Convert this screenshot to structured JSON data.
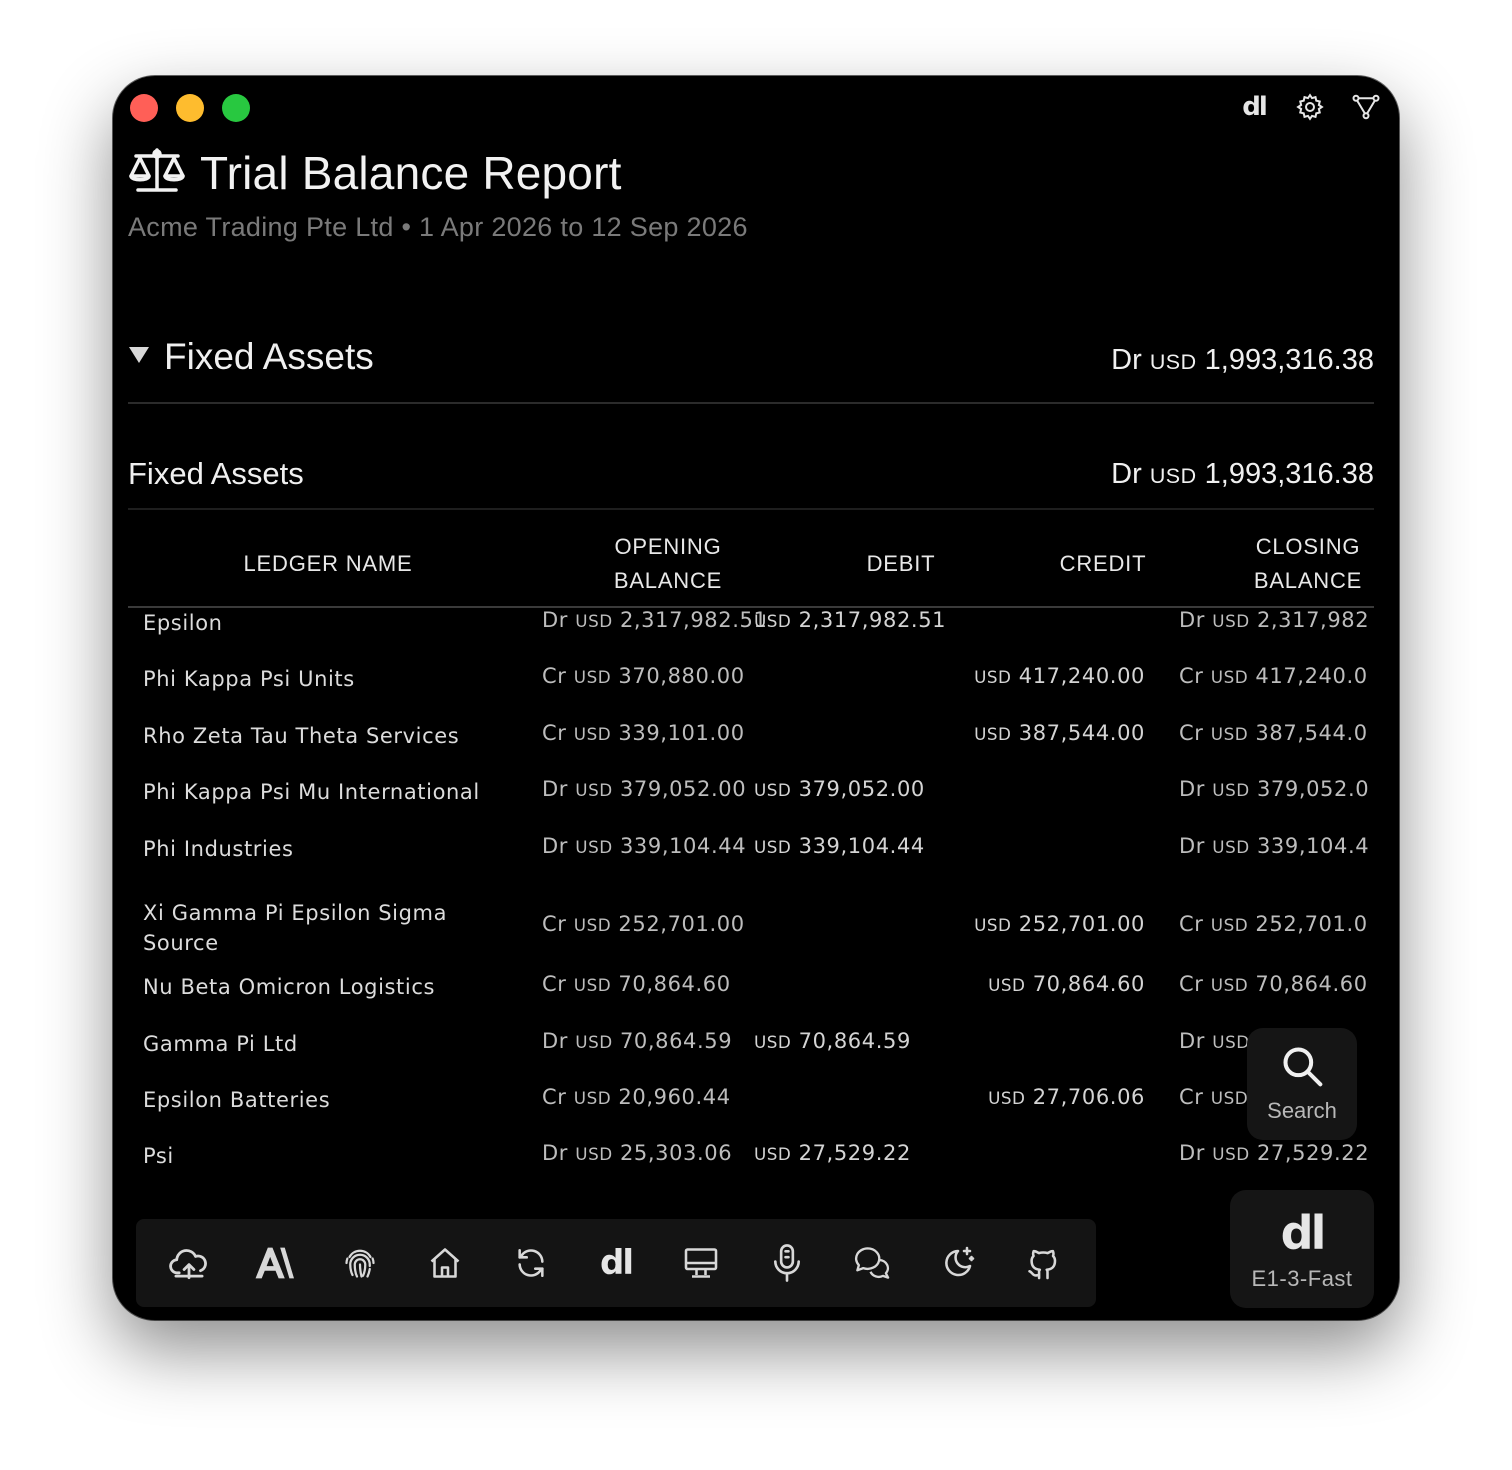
{
  "window": {
    "top_icons": [
      "dl-logo-icon",
      "gear-icon",
      "share-nodes-icon"
    ]
  },
  "header": {
    "title": "Trial Balance Report",
    "subtitle": "Acme Trading Pte Ltd • 1 Apr 2026 to 12 Sep 2026"
  },
  "group": {
    "title": "Fixed Assets",
    "amount_prefix": "Dr",
    "currency": "USD",
    "amount": "1,993,316.38"
  },
  "subgroup": {
    "title": "Fixed Assets",
    "amount_prefix": "Dr",
    "currency": "USD",
    "amount": "1,993,316.38"
  },
  "table": {
    "columns": {
      "ledger_name": "LEDGER NAME",
      "opening_line1": "OPENING",
      "opening_line2": "BALANCE",
      "debit": "DEBIT",
      "credit": "CREDIT",
      "closing_line1": "CLOSING",
      "closing_line2": "BALANCE"
    },
    "rows": [
      {
        "name": "Epsilon",
        "open_dc": "Dr",
        "open_cur": "USD",
        "open_amt": "2,317,982.51",
        "debit_cur": "USD",
        "debit_amt": "2,317,982.51",
        "credit_cur": "",
        "credit_amt": "",
        "close_dc": "Dr",
        "close_cur": "USD",
        "close_amt": "2,317,982"
      },
      {
        "name": "Phi Kappa Psi Units",
        "open_dc": "Cr",
        "open_cur": "USD",
        "open_amt": "370,880.00",
        "debit_cur": "",
        "debit_amt": "",
        "credit_cur": "USD",
        "credit_amt": "417,240.00",
        "close_dc": "Cr",
        "close_cur": "USD",
        "close_amt": "417,240.0"
      },
      {
        "name": "Rho Zeta Tau Theta Services",
        "open_dc": "Cr",
        "open_cur": "USD",
        "open_amt": "339,101.00",
        "debit_cur": "",
        "debit_amt": "",
        "credit_cur": "USD",
        "credit_amt": "387,544.00",
        "close_dc": "Cr",
        "close_cur": "USD",
        "close_amt": "387,544.0"
      },
      {
        "name": "Phi Kappa Psi Mu International",
        "open_dc": "Dr",
        "open_cur": "USD",
        "open_amt": "379,052.00",
        "debit_cur": "USD",
        "debit_amt": "379,052.00",
        "credit_cur": "",
        "credit_amt": "",
        "close_dc": "Dr",
        "close_cur": "USD",
        "close_amt": "379,052.0"
      },
      {
        "name": "Phi Industries",
        "open_dc": "Dr",
        "open_cur": "USD",
        "open_amt": "339,104.44",
        "debit_cur": "USD",
        "debit_amt": "339,104.44",
        "credit_cur": "",
        "credit_amt": "",
        "close_dc": "Dr",
        "close_cur": "USD",
        "close_amt": "339,104.4"
      },
      {
        "name": "Xi Gamma Pi Epsilon Sigma Source",
        "open_dc": "Cr",
        "open_cur": "USD",
        "open_amt": "252,701.00",
        "debit_cur": "",
        "debit_amt": "",
        "credit_cur": "USD",
        "credit_amt": "252,701.00",
        "close_dc": "Cr",
        "close_cur": "USD",
        "close_amt": "252,701.0"
      },
      {
        "name": "Nu Beta Omicron Logistics",
        "open_dc": "Cr",
        "open_cur": "USD",
        "open_amt": "70,864.60",
        "debit_cur": "",
        "debit_amt": "",
        "credit_cur": "USD",
        "credit_amt": "70,864.60",
        "close_dc": "Cr",
        "close_cur": "USD",
        "close_amt": "70,864.60"
      },
      {
        "name": "Gamma Pi Ltd",
        "open_dc": "Dr",
        "open_cur": "USD",
        "open_amt": "70,864.59",
        "debit_cur": "USD",
        "debit_amt": "70,864.59",
        "credit_cur": "",
        "credit_amt": "",
        "close_dc": "Dr",
        "close_cur": "USD",
        "close_amt": ""
      },
      {
        "name": "Epsilon Batteries",
        "open_dc": "Cr",
        "open_cur": "USD",
        "open_amt": "20,960.44",
        "debit_cur": "",
        "debit_amt": "",
        "credit_cur": "USD",
        "credit_amt": "27,706.06",
        "close_dc": "Cr",
        "close_cur": "USD",
        "close_amt": ""
      },
      {
        "name": "Psi",
        "open_dc": "Dr",
        "open_cur": "USD",
        "open_amt": "25,303.06",
        "debit_cur": "USD",
        "debit_amt": "27,529.22",
        "credit_cur": "",
        "credit_amt": "",
        "close_dc": "Dr",
        "close_cur": "USD",
        "close_amt": "27,529.22"
      }
    ]
  },
  "dock": {
    "items": [
      "cloud-upload-icon",
      "font-a-icon",
      "fingerprint-icon",
      "home-icon",
      "refresh-icon",
      "dl-logo-icon",
      "desktop-icon",
      "microphone-icon",
      "chat-icon",
      "moon-star-icon",
      "github-icon"
    ],
    "logo_text": "dl"
  },
  "search_button": {
    "label": "Search"
  },
  "model_button": {
    "logo_text": "dl",
    "label": "E1-3-Fast"
  },
  "colors": {
    "window_bg": "#000000",
    "traffic_close": "#ff5f57",
    "traffic_min": "#febc2e",
    "traffic_max": "#28c840",
    "muted_text": "#7a7a7a"
  }
}
